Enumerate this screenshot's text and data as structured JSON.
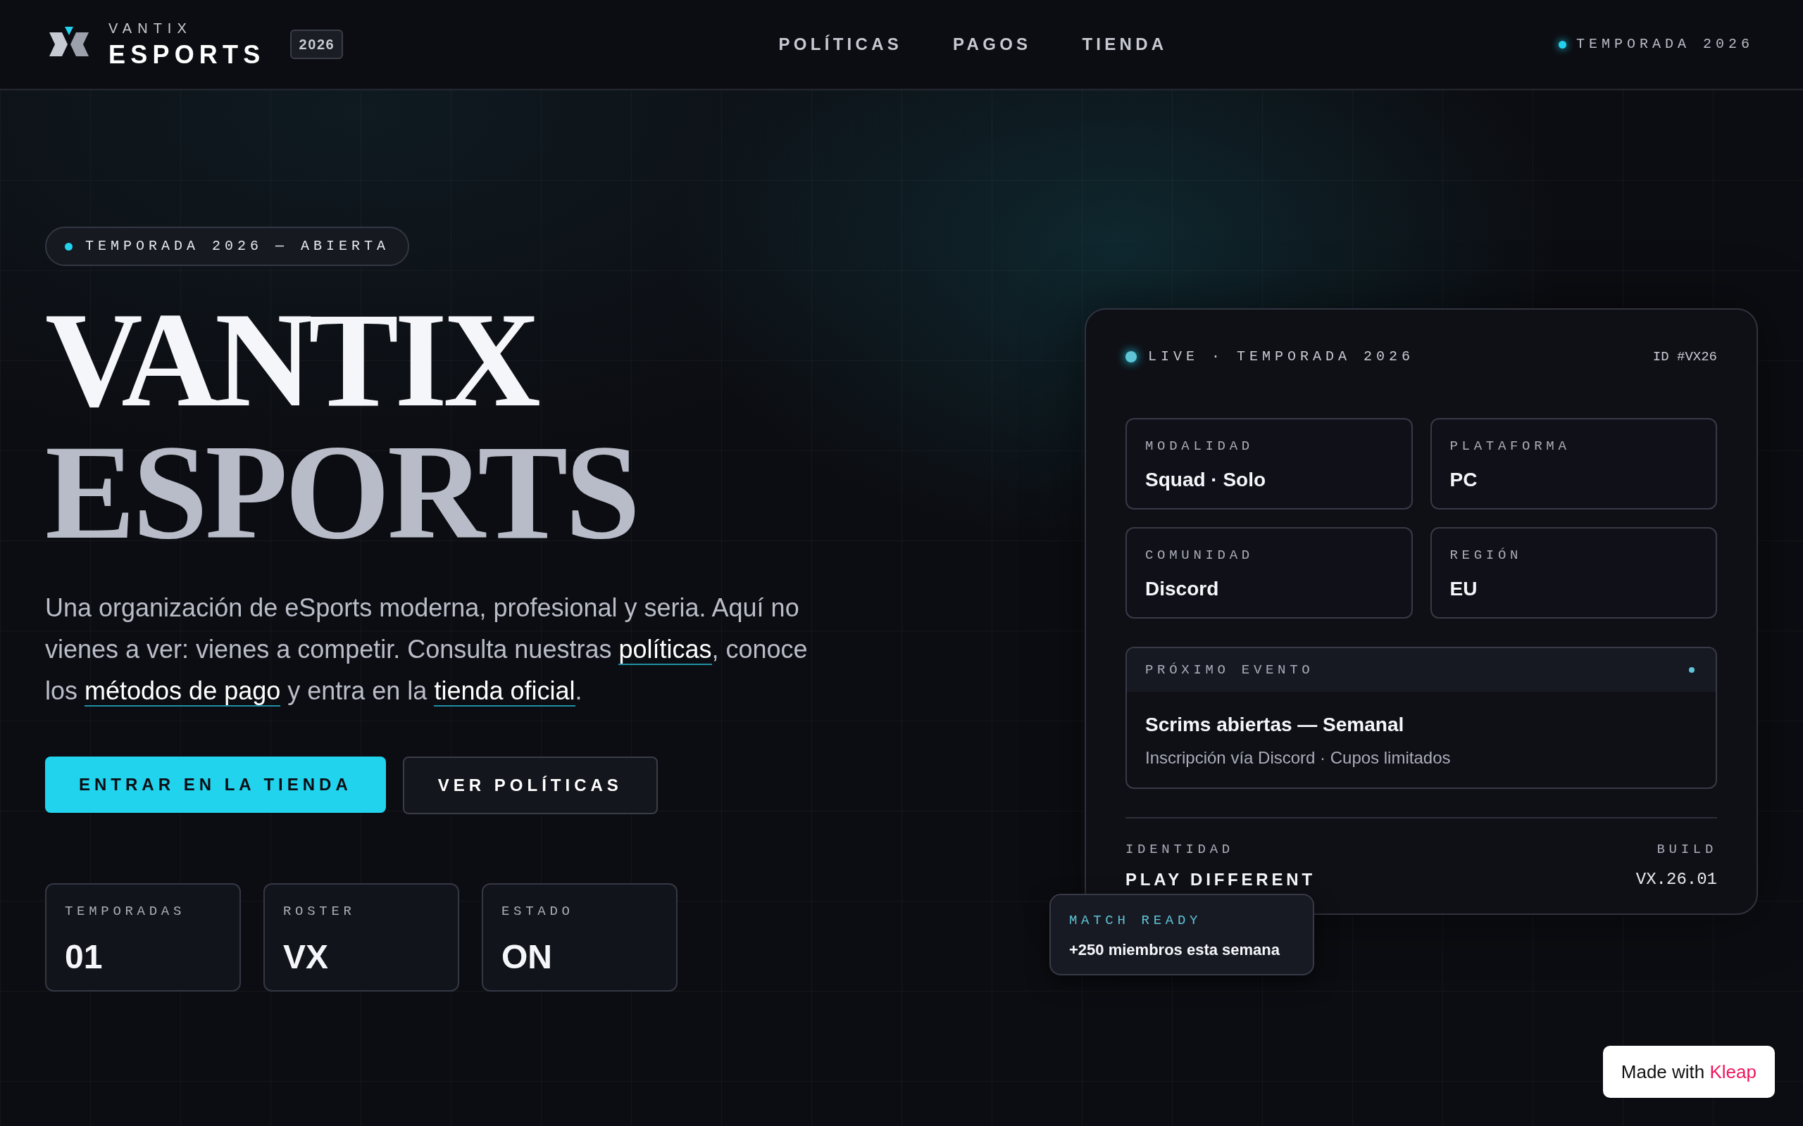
{
  "header": {
    "brand_top": "VANTIX",
    "brand_main": "ESPORTS",
    "year_badge": "2026",
    "nav": [
      {
        "label": "POLÍTICAS"
      },
      {
        "label": "PAGOS"
      },
      {
        "label": "TIENDA"
      }
    ],
    "season": "TEMPORADA 2026"
  },
  "hero": {
    "pill": "TEMPORADA 2026 — ABIERTA",
    "title_line1": "VANTIX",
    "title_line2": "ESPORTS",
    "intro": [
      {
        "kind": "text",
        "text": "Una organización de eSports moderna, profesional y seria. Aquí no vienes a ver: vienes a competir. Consulta nuestras "
      },
      {
        "kind": "link",
        "text": "políticas"
      },
      {
        "kind": "text",
        "text": ", conoce los "
      },
      {
        "kind": "link",
        "text": "métodos de pago"
      },
      {
        "kind": "text",
        "text": " y entra en la "
      },
      {
        "kind": "link",
        "text": "tienda oficial"
      },
      {
        "kind": "text",
        "text": "."
      }
    ],
    "buttons": [
      {
        "label": "ENTRAR EN LA TIENDA",
        "kind": "primary"
      },
      {
        "label": "VER POLÍTICAS",
        "kind": "secondary"
      }
    ],
    "stats": [
      {
        "label": "TEMPORADAS",
        "value": "01"
      },
      {
        "label": "ROSTER",
        "value": "VX"
      },
      {
        "label": "ESTADO",
        "value": "ON"
      }
    ]
  },
  "card": {
    "status": "LIVE · TEMPORADA 2026",
    "id": "ID #VX26",
    "tiles": [
      {
        "label": "MODALIDAD",
        "value": "Squad · Solo"
      },
      {
        "label": "PLATAFORMA",
        "value": "PC"
      },
      {
        "label": "COMUNIDAD",
        "value": "Discord"
      },
      {
        "label": "REGIÓN",
        "value": "EU"
      }
    ],
    "event": {
      "label": "PRÓXIMO EVENTO",
      "title": "Scrims abiertas — Semanal",
      "detail": "Inscripción vía Discord · Cupos limitados"
    },
    "identity_label": "IDENTIDAD",
    "identity_value": "PLAY DIFFERENT",
    "build_label": "BUILD",
    "build_value": "VX.26.01"
  },
  "toast": {
    "label": "MATCH READY",
    "text": "+250 miembros esta semana"
  },
  "made_with": {
    "text": "Made with ",
    "brand": "Kleap"
  }
}
